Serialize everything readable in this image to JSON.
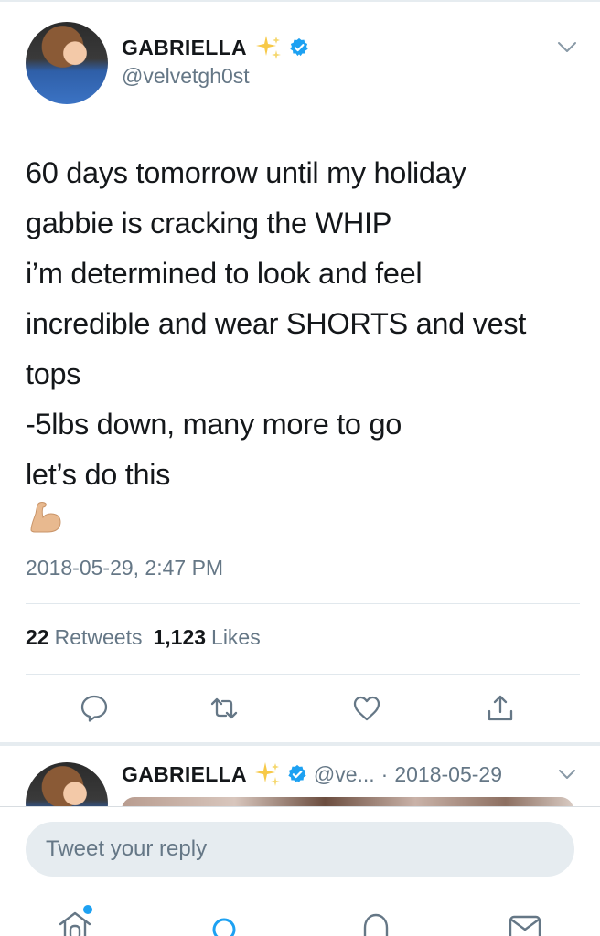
{
  "tweet": {
    "display_name": "GABRIELLA",
    "handle": "@velvetgh0st",
    "lines": [
      "60 days tomorrow until my holiday",
      "gabbie is cracking the WHIP",
      "i’m determined to look and feel",
      "incredible and wear SHORTS and vest",
      "tops",
      "-5lbs down, many more to go",
      "let’s do this"
    ],
    "emoji": "flexed-biceps-icon",
    "timestamp": "2018-05-29, 2:47 PM",
    "retweets_count": "22",
    "retweets_label": "Retweets",
    "likes_count": "1,123",
    "likes_label": "Likes",
    "icons": [
      "sparkles-icon",
      "verified-icon",
      "chevron-down-icon",
      "reply-icon",
      "retweet-icon",
      "like-icon",
      "share-icon"
    ]
  },
  "second_tweet": {
    "display_name": "GABRIELLA",
    "handle": "@ve...",
    "separator": "·",
    "date": "2018-05-29"
  },
  "reply": {
    "placeholder": "Tweet your reply"
  },
  "tabbar": {
    "items": [
      "home-icon",
      "search-icon",
      "notifications-icon",
      "messages-icon"
    ],
    "accent_color": "#1da1f2"
  },
  "colors": {
    "text": "#14171a",
    "secondary": "#657786",
    "accent": "#1da1f2",
    "divider": "#e1e8ed"
  }
}
